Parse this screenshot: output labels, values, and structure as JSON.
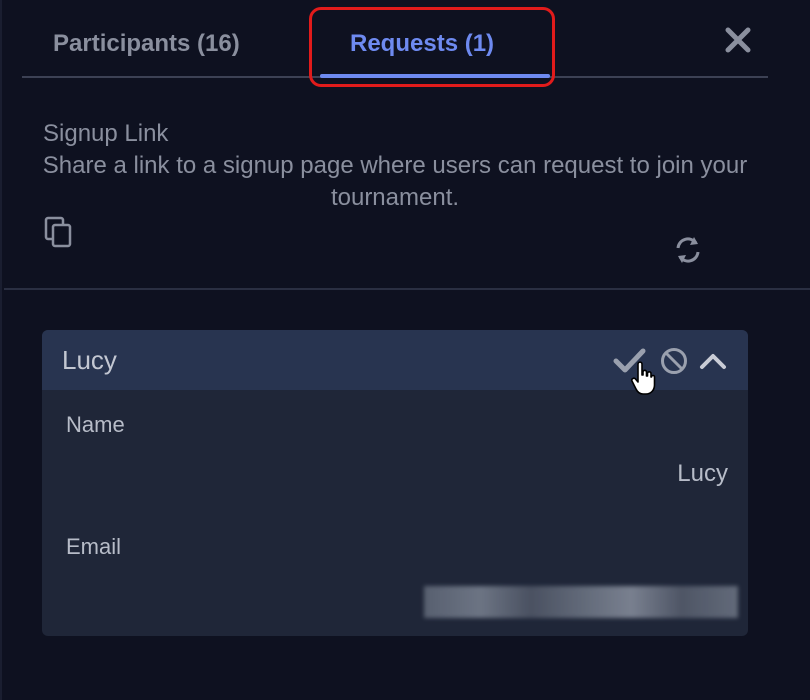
{
  "tabs": {
    "participants_label": "Participants (16)",
    "requests_label": "Requests (1)",
    "active": "requests"
  },
  "signup": {
    "title": "Signup Link",
    "description": "Share a link to a signup page where users can request to join your tournament."
  },
  "request": {
    "name": "Lucy",
    "fields": {
      "name_label": "Name",
      "name_value": "Lucy",
      "email_label": "Email"
    },
    "actions": [
      "approve",
      "deny",
      "collapse"
    ]
  },
  "colors": {
    "background": "#0e1120",
    "accent": "#6e8af0",
    "highlight": "#e11b1b",
    "card": "#1f2638",
    "card_header": "#283450"
  },
  "icons": [
    "close-icon",
    "copy-icon",
    "refresh-icon",
    "checkmark-icon",
    "block-icon",
    "chevron-up-icon",
    "hand-cursor-icon"
  ]
}
